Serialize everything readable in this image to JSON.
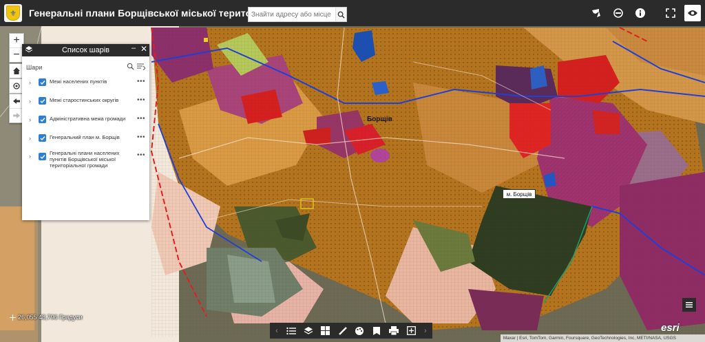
{
  "header": {
    "title": "Генеральні плани Борщівської міської територіальної громади",
    "search_placeholder": "Знайти адресу або місце"
  },
  "header_buttons": [
    "share-icon",
    "layer-swipe-icon",
    "info-icon",
    "fullscreen-icon",
    "visibility-icon"
  ],
  "map_controls": {
    "zoom_in": "+",
    "zoom_out": "−"
  },
  "layer_panel": {
    "title": "Список шарів",
    "section_label": "Шари",
    "layers": [
      {
        "name": "Межі населених пунктів",
        "checked": true
      },
      {
        "name": "Межі старостинських округів",
        "checked": true
      },
      {
        "name": "Адміністративна межа громади",
        "checked": true
      },
      {
        "name": "Генеральний план м. Борщів",
        "checked": true
      },
      {
        "name": "Генеральні плани населених пунктів Борщівської міської територіальної громади",
        "checked": true
      }
    ],
    "more_label": "•••"
  },
  "map": {
    "town_label": "Борщів",
    "town_box_label": "м. Борщів"
  },
  "coordinates": "26,055 48,796 Градуси",
  "attribution": "Maxar | Esri, TomTom, Garmin, Foursquare, GeoTechnologies, Inc, METI/NASA, USGS",
  "esri_logo": "esri",
  "colors": {
    "header_bg": "#2b2b2b",
    "checkbox": "#2d7fd3",
    "residential": "#b5751f",
    "industrial": "#a03370",
    "public": "#d62020",
    "green": "#2e3d22",
    "blue_boundary": "#1f3fd6"
  }
}
